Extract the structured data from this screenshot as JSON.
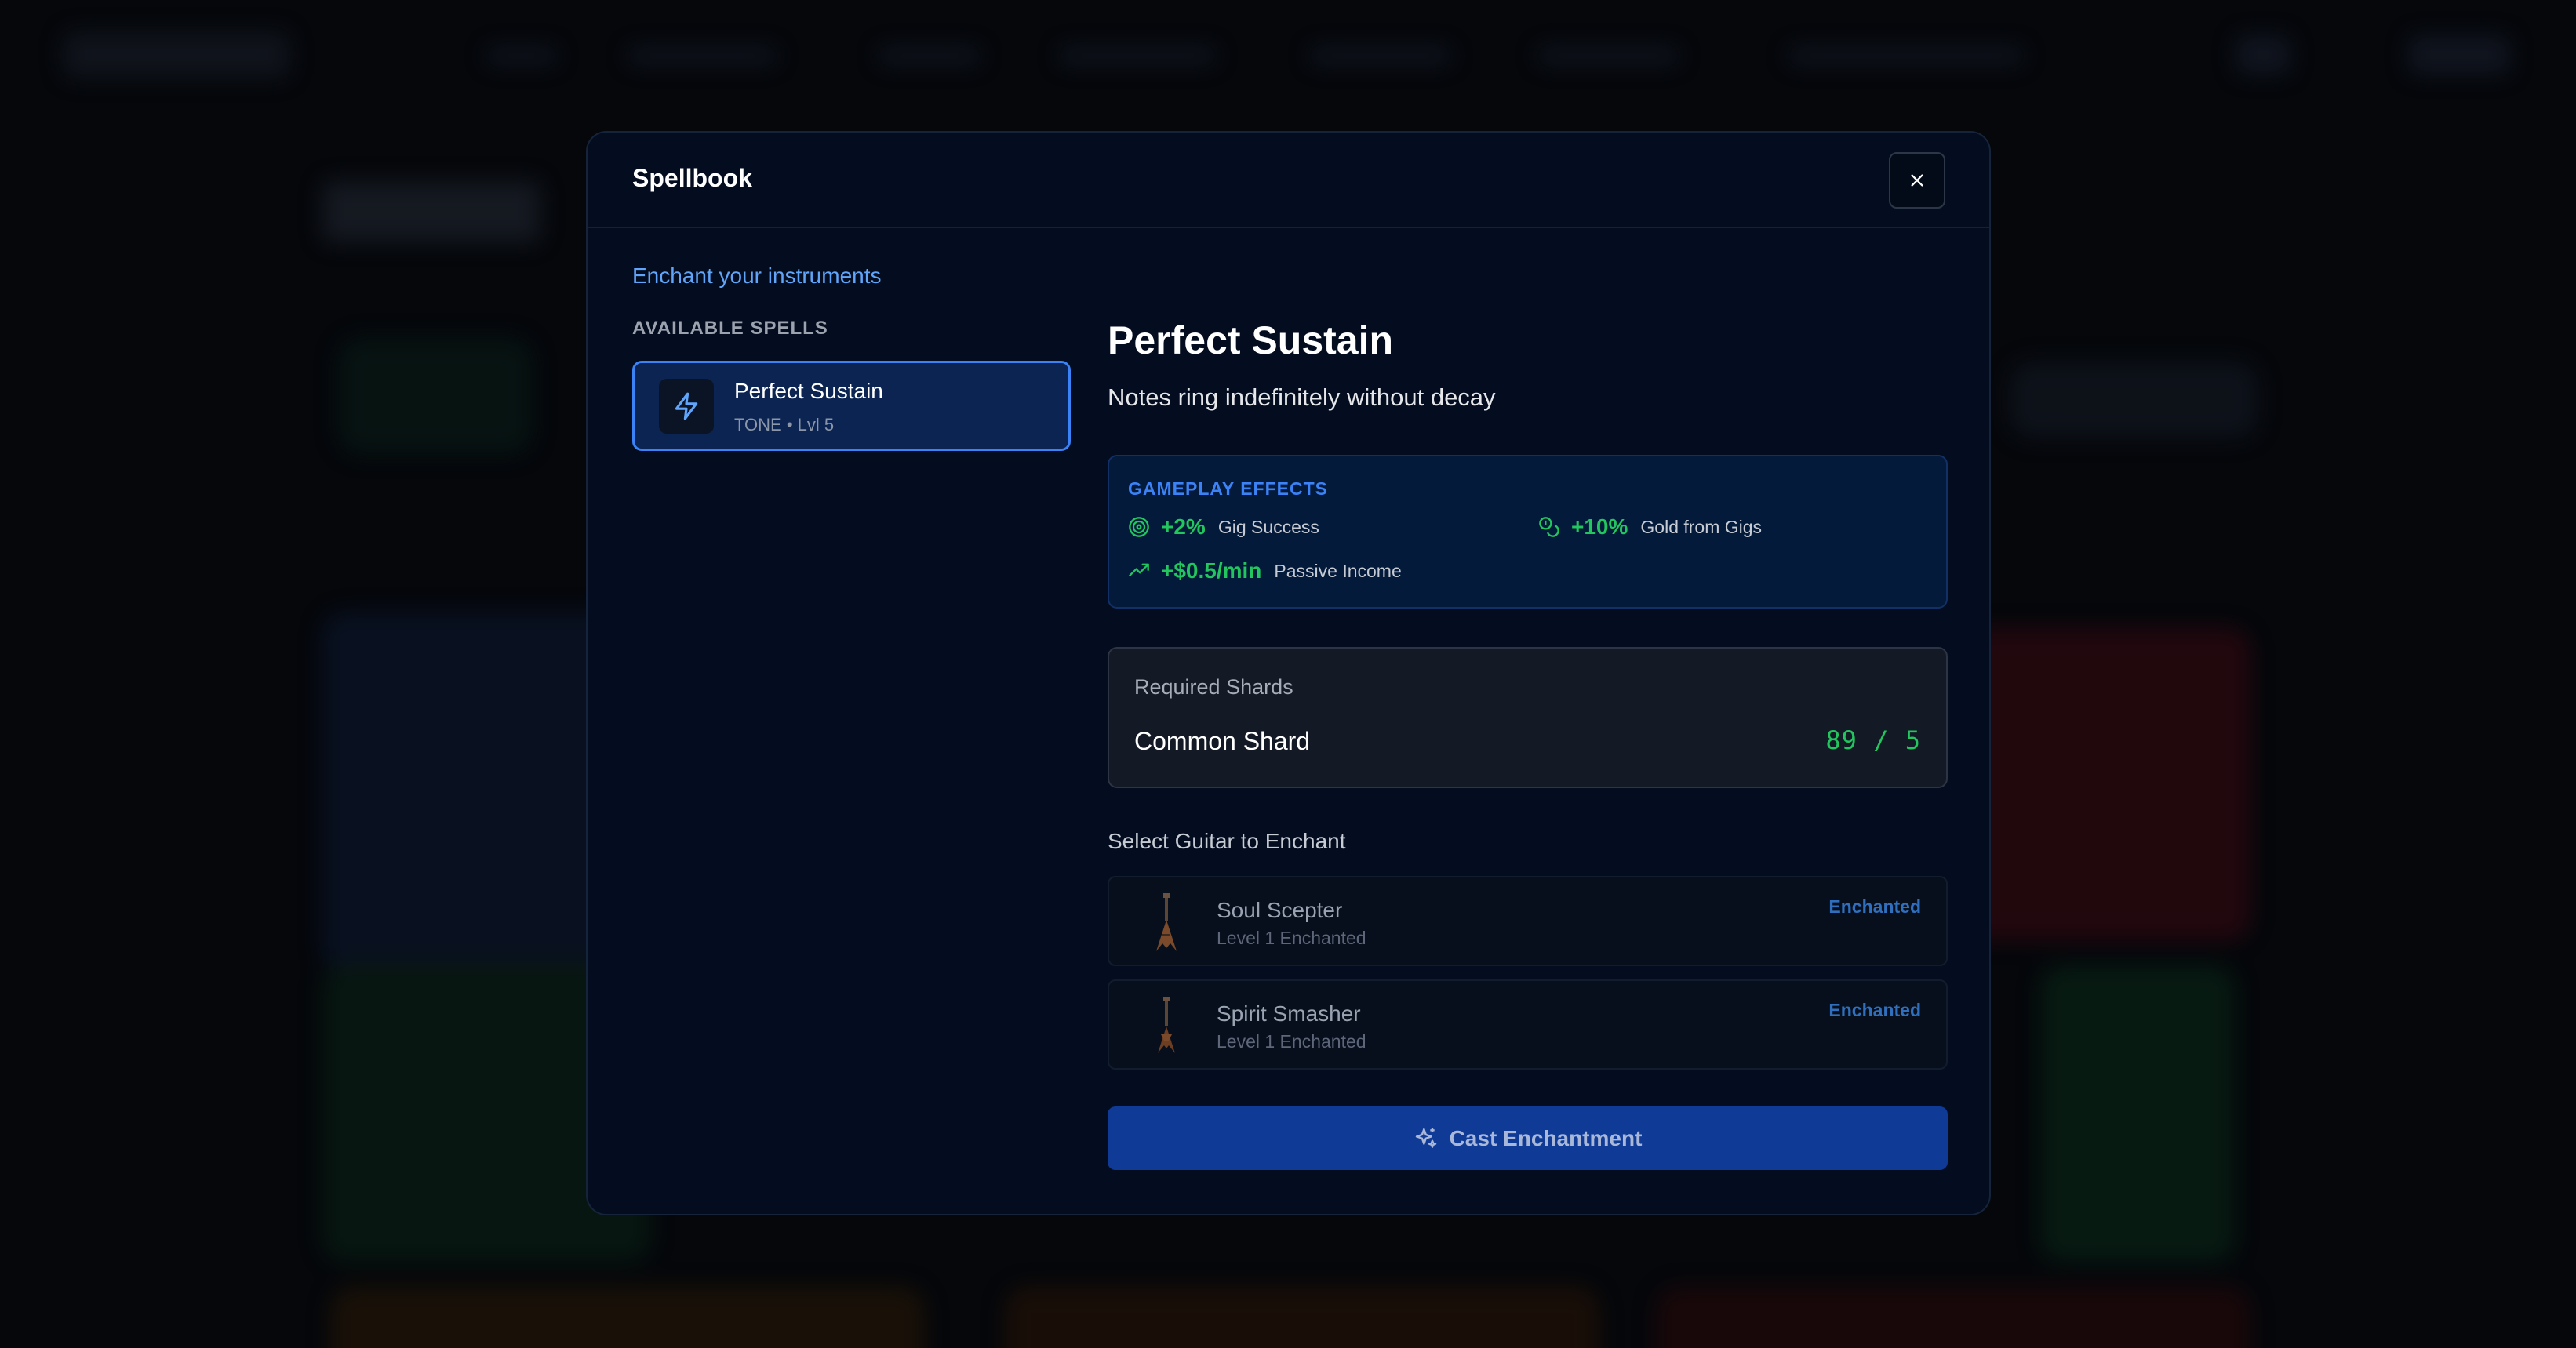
{
  "modal": {
    "title": "Spellbook",
    "subtitle": "Enchant your instruments",
    "close_icon": "close-icon"
  },
  "spells": {
    "section_label": "AVAILABLE SPELLS",
    "items": [
      {
        "name": "Perfect Sustain",
        "meta": "TONE • Lvl 5",
        "icon": "lightning-icon"
      }
    ]
  },
  "detail": {
    "title": "Perfect Sustain",
    "description": "Notes ring indefinitely without decay",
    "effects_label": "GAMEPLAY EFFECTS",
    "effects": [
      {
        "value": "+2%",
        "label": "Gig Success",
        "icon": "target-icon"
      },
      {
        "value": "+10%",
        "label": "Gold from Gigs",
        "icon": "coins-icon"
      },
      {
        "value": "+$0.5/min",
        "label": "Passive Income",
        "icon": "trending-up-icon"
      }
    ]
  },
  "shards": {
    "label": "Required Shards",
    "name": "Common Shard",
    "count": "89 / 5"
  },
  "guitars": {
    "label": "Select Guitar to Enchant",
    "items": [
      {
        "name": "Soul Scepter",
        "level": "Level 1 Enchanted",
        "status": "Enchanted",
        "icon": "guitar-icon"
      },
      {
        "name": "Spirit Smasher",
        "level": "Level 1 Enchanted",
        "status": "Enchanted",
        "icon": "guitar-icon"
      }
    ]
  },
  "cast_button": {
    "label": "Cast Enchantment",
    "icon": "sparkles-icon"
  },
  "colors": {
    "accent": "#3b82f6",
    "positive": "#22c55e",
    "modal_bg": "#030d1f",
    "button_bg": "#0f3a96"
  }
}
